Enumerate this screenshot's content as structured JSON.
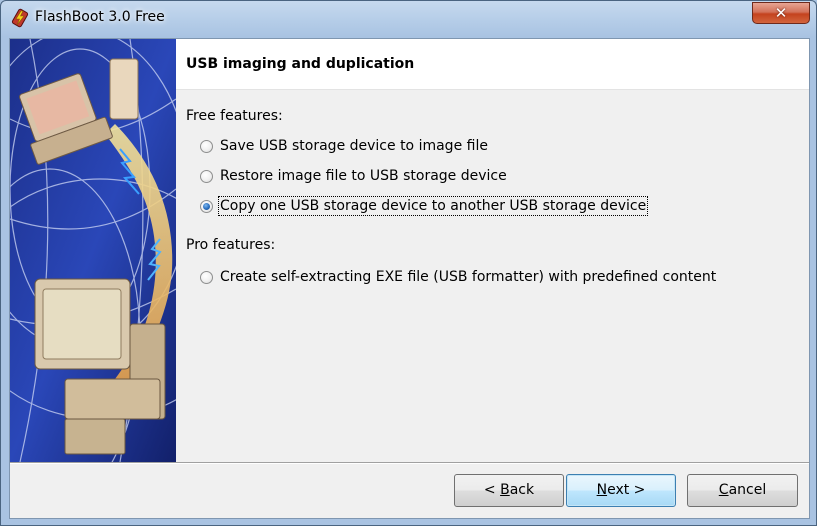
{
  "window": {
    "title": "FlashBoot 3.0 Free",
    "close_glyph": "✕"
  },
  "header": {
    "title": "USB imaging and duplication"
  },
  "sections": {
    "free_label": "Free features:",
    "pro_label": "Pro features:"
  },
  "options": [
    {
      "label": "Save USB storage device to image file",
      "checked": false
    },
    {
      "label": "Restore image file to USB storage device",
      "checked": false
    },
    {
      "label": "Copy one USB storage device to another USB storage device",
      "checked": true
    },
    {
      "label": "Create self-extracting EXE file (USB formatter) with predefined content",
      "checked": false
    }
  ],
  "buttons": {
    "back": {
      "prefix": "< ",
      "accel": "B",
      "rest": "ack"
    },
    "next": {
      "accel": "N",
      "rest": "ext >"
    },
    "cancel": {
      "accel": "C",
      "rest": "ancel"
    }
  },
  "icons": {
    "app": "flashboot-usb-lightning-icon",
    "close": "close-icon"
  },
  "colors": {
    "titlebar": "#b5cde8",
    "client_bg": "#f0f0f0",
    "header_bg": "#ffffff",
    "default_button": "#bee6fd",
    "close_button": "#c4421e"
  }
}
